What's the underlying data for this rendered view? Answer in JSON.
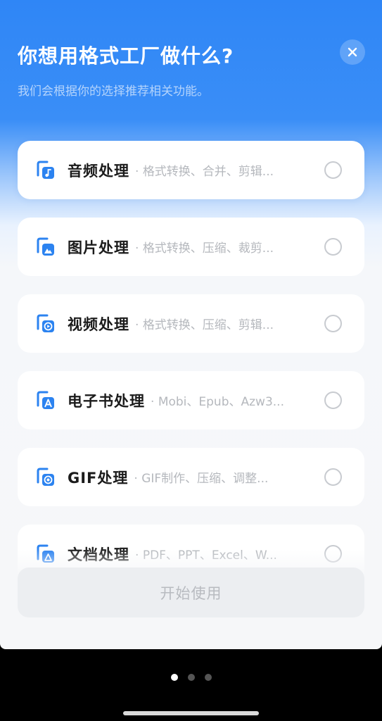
{
  "header": {
    "title": "你想用格式工厂做什么?",
    "subtitle": "我们会根据你的选择推荐相关功能。"
  },
  "close_icon": "close-icon",
  "options": [
    {
      "title": "音频处理",
      "desc": "格式转换、合并、剪辑...",
      "icon": "audio-file-icon",
      "selected": false
    },
    {
      "title": "图片处理",
      "desc": "格式转换、压缩、裁剪...",
      "icon": "image-file-icon",
      "selected": false
    },
    {
      "title": "视频处理",
      "desc": "格式转换、压缩、剪辑...",
      "icon": "video-file-icon",
      "selected": false
    },
    {
      "title": "电子书处理",
      "desc": "Mobi、Epub、Azw3...",
      "icon": "ebook-file-icon",
      "selected": false
    },
    {
      "title": "GIF处理",
      "desc": "GIF制作、压缩、调整...",
      "icon": "gif-file-icon",
      "selected": false
    },
    {
      "title": "文档处理",
      "desc": "PDF、PPT、Excel、W...",
      "icon": "document-file-icon",
      "selected": false
    }
  ],
  "start_button": {
    "label": "开始使用",
    "enabled": false
  },
  "pager": {
    "count": 3,
    "active": 0
  },
  "colors": {
    "brand_blue": "#2f86f6",
    "icon_blue": "#2c83f0",
    "disabled_bg": "#eceef1",
    "disabled_text": "#b8bbc0"
  }
}
